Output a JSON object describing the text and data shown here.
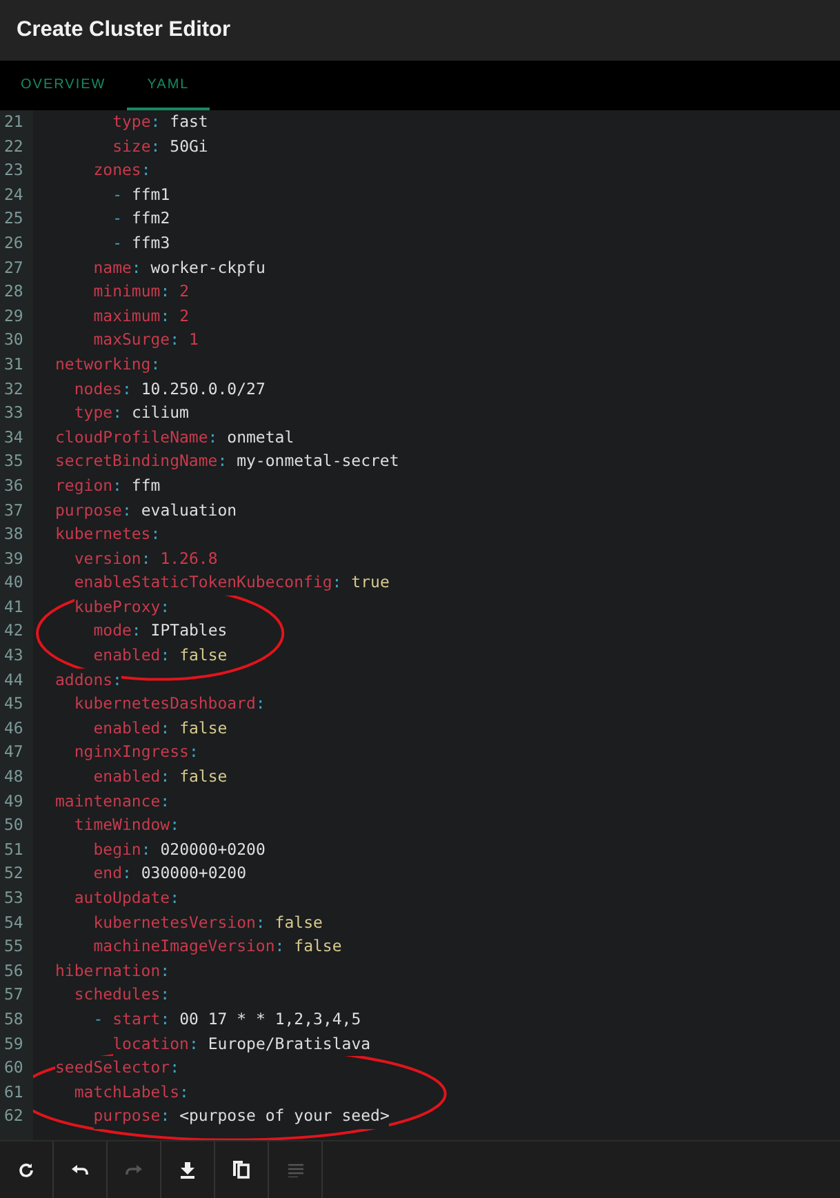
{
  "window": {
    "title": "Create Cluster Editor"
  },
  "tabs": [
    {
      "label": "OVERVIEW",
      "selected": false
    },
    {
      "label": "YAML",
      "selected": true
    }
  ],
  "editor": {
    "lines": [
      {
        "children": [
          {
            "children": [
              {
                "children": [
                  {
                    "n": "21",
                    "circled": false,
                    "tokens": [
                      {
                        "t": "type",
                        "kind": "key"
                      },
                      {
                        "t": ":",
                        "kind": "colon"
                      },
                      {
                        "t": "fast",
                        "kind": "string"
                      }
                    ]
                  },
                  {
                    "n": "22",
                    "circled": false,
                    "tokens": [
                      {
                        "t": "size",
                        "kind": "key"
                      },
                      {
                        "t": ":",
                        "kind": "colon"
                      },
                      {
                        "t": "50Gi",
                        "kind": "string"
                      }
                    ]
                  }
                ]
              },
              {
                "n": "23",
                "circled": false,
                "tokens": [
                  {
                    "t": "zones",
                    "kind": "key"
                  },
                  {
                    "t": ":",
                    "kind": "colon"
                  }
                ],
                "children": [
                  {
                    "n": "24",
                    "circled": false,
                    "tokens": [
                      {
                        "t": "-",
                        "kind": "dash"
                      },
                      {
                        "t": "ffm1",
                        "kind": "string"
                      }
                    ]
                  },
                  {
                    "n": "25",
                    "circled": false,
                    "tokens": [
                      {
                        "t": "-",
                        "kind": "dash"
                      },
                      {
                        "t": "ffm2",
                        "kind": "string"
                      }
                    ]
                  },
                  {
                    "n": "26",
                    "circled": false,
                    "tokens": [
                      {
                        "t": "-",
                        "kind": "dash"
                      },
                      {
                        "t": "ffm3",
                        "kind": "string"
                      }
                    ]
                  }
                ]
              },
              {
                "n": "27",
                "circled": false,
                "tokens": [
                  {
                    "t": "name",
                    "kind": "key"
                  },
                  {
                    "t": ":",
                    "kind": "colon"
                  },
                  {
                    "t": "worker-ckpfu",
                    "kind": "string"
                  }
                ]
              },
              {
                "n": "28",
                "circled": false,
                "tokens": [
                  {
                    "t": "minimum",
                    "kind": "key"
                  },
                  {
                    "t": ":",
                    "kind": "colon"
                  },
                  {
                    "t": "2",
                    "kind": "number"
                  }
                ]
              },
              {
                "n": "29",
                "circled": false,
                "tokens": [
                  {
                    "t": "maximum",
                    "kind": "key"
                  },
                  {
                    "t": ":",
                    "kind": "colon"
                  },
                  {
                    "t": "2",
                    "kind": "number"
                  }
                ]
              },
              {
                "n": "30",
                "circled": false,
                "tokens": [
                  {
                    "t": "maxSurge",
                    "kind": "key"
                  },
                  {
                    "t": ":",
                    "kind": "colon"
                  },
                  {
                    "t": "1",
                    "kind": "number"
                  }
                ]
              }
            ]
          }
        ]
      },
      {
        "n": "31",
        "circled": false,
        "tokens": [
          {
            "t": "networking",
            "kind": "key"
          },
          {
            "t": ":",
            "kind": "colon"
          }
        ],
        "children": [
          {
            "n": "32",
            "circled": false,
            "tokens": [
              {
                "t": "nodes",
                "kind": "key"
              },
              {
                "t": ":",
                "kind": "colon"
              },
              {
                "t": "10.250.0.0/27",
                "kind": "string"
              }
            ]
          },
          {
            "n": "33",
            "circled": false,
            "tokens": [
              {
                "t": "type",
                "kind": "key"
              },
              {
                "t": ":",
                "kind": "colon"
              },
              {
                "t": "cilium",
                "kind": "string"
              }
            ]
          }
        ]
      },
      {
        "n": "34",
        "circled": false,
        "tokens": [
          {
            "t": "cloudProfileName",
            "kind": "key"
          },
          {
            "t": ":",
            "kind": "colon"
          },
          {
            "t": "onmetal",
            "kind": "string"
          }
        ]
      },
      {
        "n": "35",
        "circled": false,
        "tokens": [
          {
            "t": "secretBindingName",
            "kind": "key"
          },
          {
            "t": ":",
            "kind": "colon"
          },
          {
            "t": "my-onmetal-secret",
            "kind": "string"
          }
        ]
      },
      {
        "n": "36",
        "circled": false,
        "tokens": [
          {
            "t": "region",
            "kind": "key"
          },
          {
            "t": ":",
            "kind": "colon"
          },
          {
            "t": "ffm",
            "kind": "string"
          }
        ]
      },
      {
        "n": "37",
        "circled": false,
        "tokens": [
          {
            "t": "purpose",
            "kind": "key"
          },
          {
            "t": ":",
            "kind": "colon"
          },
          {
            "t": "evaluation",
            "kind": "string"
          }
        ]
      },
      {
        "n": "38",
        "circled": false,
        "tokens": [
          {
            "t": "kubernetes",
            "kind": "key"
          },
          {
            "t": ":",
            "kind": "colon"
          }
        ],
        "children": [
          {
            "n": "39",
            "circled": false,
            "tokens": [
              {
                "t": "version",
                "kind": "key"
              },
              {
                "t": ":",
                "kind": "colon"
              },
              {
                "t": "1.26.8",
                "kind": "number"
              }
            ]
          },
          {
            "n": "40",
            "circled": false,
            "tokens": [
              {
                "t": "enableStaticTokenKubeconfig",
                "kind": "key"
              },
              {
                "t": ":",
                "kind": "colon"
              },
              {
                "t": "true",
                "kind": "boolean"
              }
            ]
          },
          {
            "n": "41",
            "circled": true,
            "tokens": [
              {
                "t": "kubeProxy",
                "kind": "key"
              },
              {
                "t": ":",
                "kind": "colon"
              }
            ],
            "children": [
              {
                "n": "42",
                "circled": true,
                "tokens": [
                  {
                    "t": "mode",
                    "kind": "key"
                  },
                  {
                    "t": ":",
                    "kind": "colon"
                  },
                  {
                    "t": "IPTables",
                    "kind": "string"
                  }
                ]
              },
              {
                "n": "43",
                "circled": true,
                "tokens": [
                  {
                    "t": "enabled",
                    "kind": "key"
                  },
                  {
                    "t": ":",
                    "kind": "colon"
                  },
                  {
                    "t": "false",
                    "kind": "boolean"
                  }
                ]
              }
            ]
          }
        ]
      },
      {
        "n": "44",
        "circled": false,
        "tokens": [
          {
            "t": "addons",
            "kind": "key"
          },
          {
            "t": ":",
            "kind": "colon"
          }
        ],
        "children": [
          {
            "n": "45",
            "circled": false,
            "tokens": [
              {
                "t": "kubernetesDashboard",
                "kind": "key"
              },
              {
                "t": ":",
                "kind": "colon"
              }
            ],
            "children": [
              {
                "n": "46",
                "circled": false,
                "tokens": [
                  {
                    "t": "enabled",
                    "kind": "key"
                  },
                  {
                    "t": ":",
                    "kind": "colon"
                  },
                  {
                    "t": "false",
                    "kind": "boolean"
                  }
                ]
              }
            ]
          },
          {
            "n": "47",
            "circled": false,
            "tokens": [
              {
                "t": "nginxIngress",
                "kind": "key"
              },
              {
                "t": ":",
                "kind": "colon"
              }
            ],
            "children": [
              {
                "n": "48",
                "circled": false,
                "tokens": [
                  {
                    "t": "enabled",
                    "kind": "key"
                  },
                  {
                    "t": ":",
                    "kind": "colon"
                  },
                  {
                    "t": "false",
                    "kind": "boolean"
                  }
                ]
              }
            ]
          }
        ]
      },
      {
        "n": "49",
        "circled": false,
        "tokens": [
          {
            "t": "maintenance",
            "kind": "key"
          },
          {
            "t": ":",
            "kind": "colon"
          }
        ],
        "children": [
          {
            "n": "50",
            "circled": false,
            "tokens": [
              {
                "t": "timeWindow",
                "kind": "key"
              },
              {
                "t": ":",
                "kind": "colon"
              }
            ],
            "children": [
              {
                "n": "51",
                "circled": false,
                "tokens": [
                  {
                    "t": "begin",
                    "kind": "key"
                  },
                  {
                    "t": ":",
                    "kind": "colon"
                  },
                  {
                    "t": "020000+0200",
                    "kind": "string"
                  }
                ]
              },
              {
                "n": "52",
                "circled": false,
                "tokens": [
                  {
                    "t": "end",
                    "kind": "key"
                  },
                  {
                    "t": ":",
                    "kind": "colon"
                  },
                  {
                    "t": "030000+0200",
                    "kind": "string"
                  }
                ]
              }
            ]
          },
          {
            "n": "53",
            "circled": false,
            "tokens": [
              {
                "t": "autoUpdate",
                "kind": "key"
              },
              {
                "t": ":",
                "kind": "colon"
              }
            ],
            "children": [
              {
                "n": "54",
                "circled": false,
                "tokens": [
                  {
                    "t": "kubernetesVersion",
                    "kind": "key"
                  },
                  {
                    "t": ":",
                    "kind": "colon"
                  },
                  {
                    "t": "false",
                    "kind": "boolean"
                  }
                ]
              },
              {
                "n": "55",
                "circled": false,
                "tokens": [
                  {
                    "t": "machineImageVersion",
                    "kind": "key"
                  },
                  {
                    "t": ":",
                    "kind": "colon"
                  },
                  {
                    "t": "false",
                    "kind": "boolean"
                  }
                ]
              }
            ]
          }
        ]
      },
      {
        "n": "56",
        "circled": false,
        "tokens": [
          {
            "t": "hibernation",
            "kind": "key"
          },
          {
            "t": ":",
            "kind": "colon"
          }
        ],
        "children": [
          {
            "n": "57",
            "circled": false,
            "tokens": [
              {
                "t": "schedules",
                "kind": "key"
              },
              {
                "t": ":",
                "kind": "colon"
              }
            ],
            "children": [
              {
                "n": "58",
                "circled": false,
                "tokens": [
                  {
                    "t": "-",
                    "kind": "dash"
                  },
                  {
                    "t": "start",
                    "kind": "key"
                  },
                  {
                    "t": ":",
                    "kind": "colon"
                  },
                  {
                    "t": "00 17 * * 1,2,3,4,5",
                    "kind": "string"
                  }
                ],
                "children": [
                  {
                    "n": "59",
                    "circled": false,
                    "tokens": [
                      {
                        "t": "location",
                        "kind": "key"
                      },
                      {
                        "t": ":",
                        "kind": "colon"
                      },
                      {
                        "t": "Europe/Bratislava",
                        "kind": "string"
                      }
                    ]
                  }
                ]
              }
            ]
          }
        ]
      },
      {
        "n": "60",
        "circled": true,
        "tokens": [
          {
            "t": "seedSelector",
            "kind": "key"
          },
          {
            "t": ":",
            "kind": "colon"
          }
        ],
        "children": [
          {
            "n": "61",
            "circled": true,
            "tokens": [
              {
                "t": "matchLabels",
                "kind": "key"
              },
              {
                "t": ":",
                "kind": "colon"
              }
            ],
            "children": [
              {
                "n": "62",
                "circled": true,
                "tokens": [
                  {
                    "t": "purpose",
                    "kind": "key"
                  },
                  {
                    "t": ":",
                    "kind": "colon"
                  },
                  {
                    "t": "<purpose of your seed>",
                    "kind": "string"
                  }
                ]
              }
            ]
          }
        ]
      }
    ]
  },
  "toolbar": [
    {
      "kind": "refresh",
      "disabled": false
    },
    {
      "kind": "undo",
      "disabled": false
    },
    {
      "kind": "redo",
      "disabled": true
    },
    {
      "kind": "download",
      "disabled": false
    },
    {
      "kind": "copy",
      "disabled": false
    },
    {
      "kind": "format",
      "disabled": true
    }
  ]
}
